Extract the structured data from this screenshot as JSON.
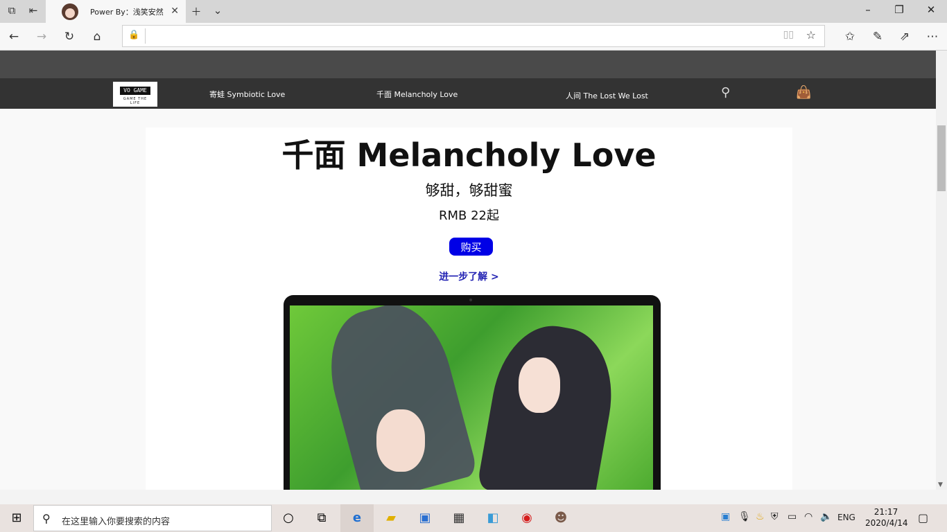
{
  "browser": {
    "tab_title": "Power By：浅笑安然",
    "address_value": "",
    "address_placeholder": ""
  },
  "site": {
    "logo_line1": "VO GAME",
    "logo_line2": "GAME THE LIFE",
    "nav": [
      {
        "label": "寄蛙 Symbiotic Love"
      },
      {
        "label": "千面 Melancholy Love"
      },
      {
        "label": "人间 The Lost We Lost"
      }
    ],
    "hero": {
      "title": "千面 Melancholy Love",
      "subtitle": "够甜，够甜蜜",
      "price": "RMB 22起",
      "buy_label": "购买",
      "more_label": "进一步了解 >"
    }
  },
  "taskbar": {
    "search_placeholder": "在这里输入你要搜索的内容",
    "lang": "ENG",
    "time": "21:17",
    "date": "2020/4/14"
  },
  "colors": {
    "buy_button": "#0000e6",
    "link": "#2222b3",
    "site_nav_bg": "#333333"
  }
}
